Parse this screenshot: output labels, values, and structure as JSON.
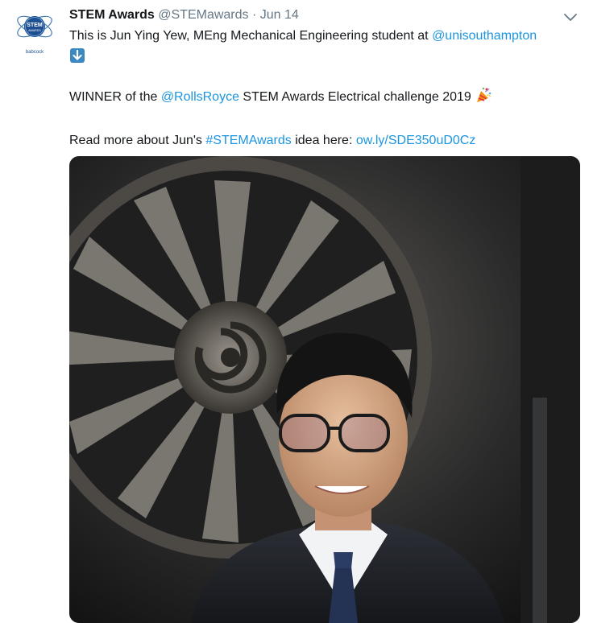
{
  "tweet": {
    "display_name": "STEM Awards",
    "handle": "@STEMawards",
    "separator": "·",
    "date": "Jun 14",
    "line1_text": "This is Jun Ying Yew, MEng Mechanical Engineering student at ",
    "mention_uni": "@unisouthampton",
    "arrow_emoji": "down-arrow-emoji",
    "line2_prefix": "WINNER of the ",
    "mention_rr": "@RollsRoyce",
    "line2_suffix": " STEM Awards Electrical challenge 2019",
    "party_emoji": "party-popper-emoji",
    "line3_prefix": "Read more about Jun's ",
    "hashtag": "#STEMAwards",
    "line3_middle": " idea here: ",
    "url": "ow.ly/SDE350uD0Cz"
  },
  "avatar": {
    "logo_text": "STEM",
    "logo_sub": "AWARDS",
    "sponsor": "babcock",
    "icon": "atom-logo"
  },
  "colors": {
    "link": "#1b95e0",
    "text": "#14171a",
    "muted": "#657786",
    "arrow_bg": "#3b88c3"
  }
}
